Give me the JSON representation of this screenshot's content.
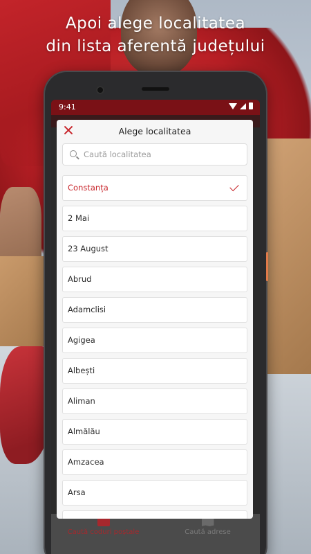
{
  "promo": {
    "headline_line1": "Apoi alege localitatea",
    "headline_line2": "din lista aferentă județului"
  },
  "status_bar": {
    "time": "9:41",
    "icons": [
      "wifi-icon",
      "signal-icon",
      "battery-icon"
    ]
  },
  "dialog": {
    "title": "Alege localitatea",
    "close_icon": "close-icon",
    "search": {
      "placeholder": "Caută localitatea",
      "value": ""
    },
    "selected": "Constanța",
    "items": [
      {
        "label": "Constanța",
        "selected": true
      },
      {
        "label": "2 Mai",
        "selected": false
      },
      {
        "label": "23 August",
        "selected": false
      },
      {
        "label": "Abrud",
        "selected": false
      },
      {
        "label": "Adamclisi",
        "selected": false
      },
      {
        "label": "Agigea",
        "selected": false
      },
      {
        "label": "Albești",
        "selected": false
      },
      {
        "label": "Aliman",
        "selected": false
      },
      {
        "label": "Almălău",
        "selected": false
      },
      {
        "label": "Amzacea",
        "selected": false
      },
      {
        "label": "Arsa",
        "selected": false
      }
    ]
  },
  "bottom_nav": {
    "items": [
      {
        "label": "Caută coduri poștale",
        "icon": "mail-icon",
        "active": true
      },
      {
        "label": "Caută adrese",
        "icon": "map-icon",
        "active": false
      }
    ]
  },
  "colors": {
    "accent": "#c8252b",
    "status_bar": "#7a1116"
  }
}
